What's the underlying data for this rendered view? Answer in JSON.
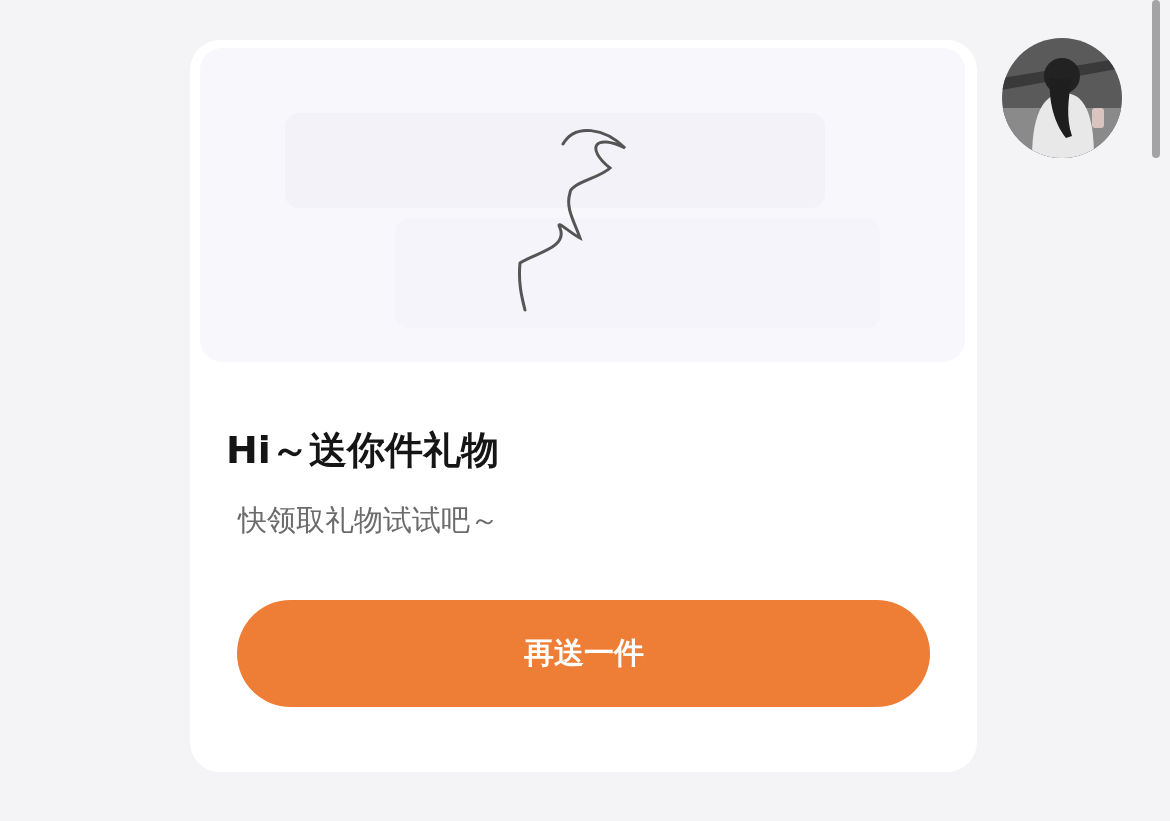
{
  "message": {
    "title": "Hi～送你件礼物",
    "subtitle": "快领取礼物试试吧～",
    "button": "再送一件"
  }
}
